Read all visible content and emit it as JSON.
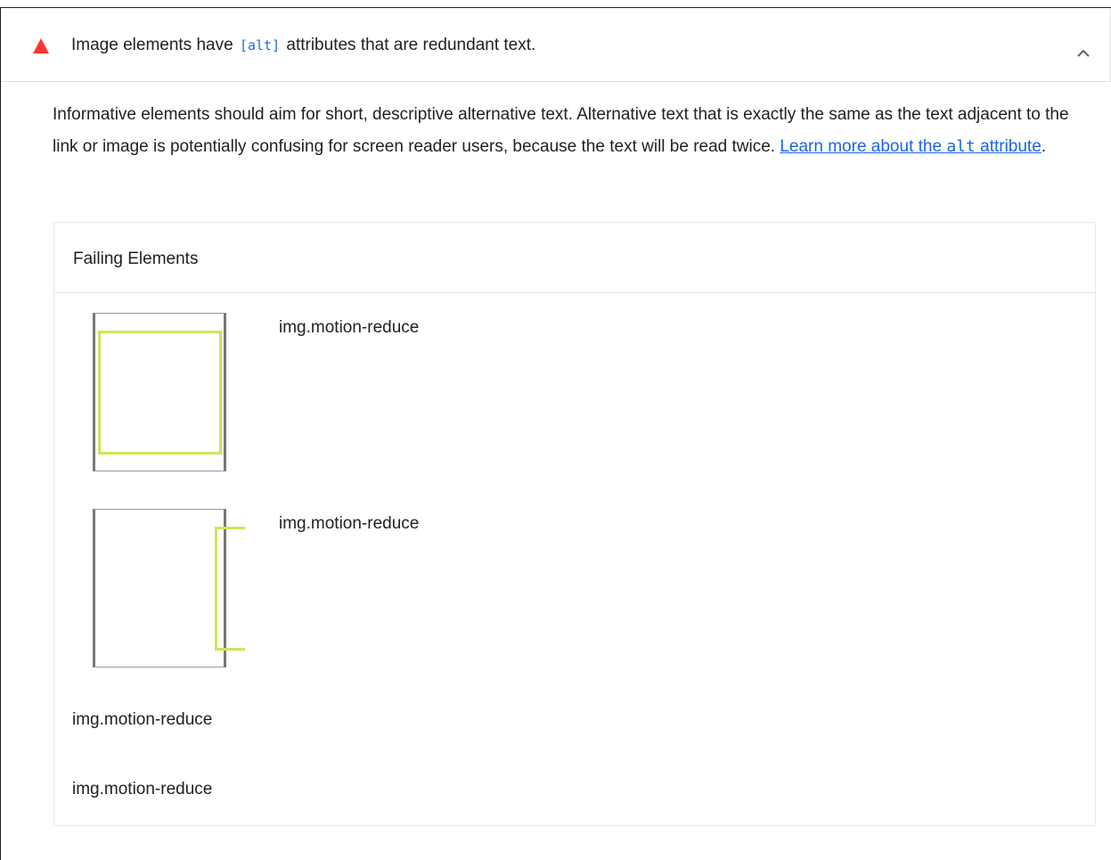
{
  "audit": {
    "title_prefix": "Image elements have ",
    "title_code": "[alt]",
    "title_suffix": " attributes that are redundant text.",
    "status_color": "#ff3333",
    "expand_icon": "chevron-up-icon"
  },
  "description": {
    "text": "Informative elements should aim for short, descriptive alternative text. Alternative text that is exactly the same as the text adjacent to the link or image is potentially confusing for screen reader users, because the text will be read twice. ",
    "link_prefix": "Learn more about the ",
    "link_code": "alt",
    "link_suffix": " attribute",
    "trailing": "."
  },
  "details": {
    "heading": "Failing Elements",
    "items": [
      {
        "label": "img.motion-reduce"
      },
      {
        "label": "img.motion-reduce"
      },
      {
        "label": "img.motion-reduce"
      },
      {
        "label": "img.motion-reduce"
      }
    ]
  },
  "colors": {
    "highlight": "#d4e157",
    "link": "#1a64e8",
    "code": "#1e6ae0"
  }
}
